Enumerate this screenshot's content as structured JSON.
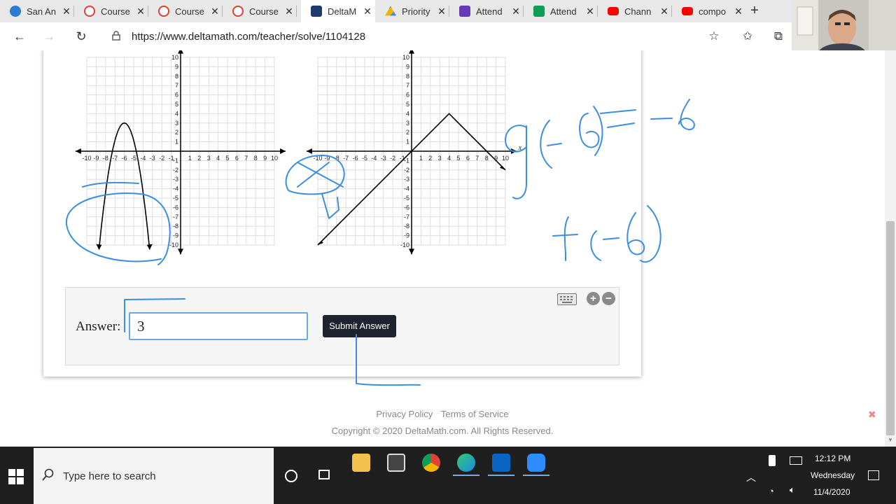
{
  "browser": {
    "tabs": [
      {
        "label": "San An",
        "icon": "onedrive-icon",
        "color": "#2b7cd3"
      },
      {
        "label": "Course",
        "icon": "canvas-icon",
        "color": "#d94136"
      },
      {
        "label": "Course",
        "icon": "canvas-icon",
        "color": "#d94136"
      },
      {
        "label": "Course",
        "icon": "canvas-icon",
        "color": "#d94136"
      },
      {
        "label": "DeltaM",
        "icon": "deltamath-icon",
        "color": "#1f3b6e"
      },
      {
        "label": "Priority",
        "icon": "google-drive-icon",
        "color": "#f4b400"
      },
      {
        "label": "Attend",
        "icon": "forms-icon",
        "color": "#673ab7"
      },
      {
        "label": "Attend",
        "icon": "sheets-icon",
        "color": "#0f9d58"
      },
      {
        "label": "Chann",
        "icon": "youtube-icon",
        "color": "#ff0000"
      },
      {
        "label": "compo",
        "icon": "youtube-icon",
        "color": "#ff0000"
      }
    ],
    "active_tab": 4,
    "url": "https://www.deltamath.com/teacher/solve/1104128"
  },
  "graphs": {
    "left": {
      "x_ticks": [
        "-10",
        "-9",
        "-8",
        "-7",
        "-6",
        "-5",
        "-4",
        "-3",
        "-2",
        "-1",
        "1",
        "2",
        "3",
        "4",
        "5",
        "6",
        "7",
        "8",
        "9",
        "10"
      ],
      "y_ticks": [
        "10",
        "9",
        "8",
        "7",
        "6",
        "5",
        "4",
        "3",
        "2",
        "1",
        "-1",
        "-2",
        "-3",
        "-4",
        "-5",
        "-6",
        "-7",
        "-8",
        "-9",
        "-10"
      ]
    },
    "right": {
      "x_ticks": [
        "-10",
        "-9",
        "-8",
        "-7",
        "-6",
        "-5",
        "-4",
        "-3",
        "-2",
        "-1",
        "1",
        "2",
        "3",
        "4",
        "5",
        "6",
        "7",
        "8",
        "9",
        "10"
      ],
      "y_ticks": [
        "10",
        "9",
        "8",
        "7",
        "6",
        "5",
        "4",
        "3",
        "2",
        "1",
        "-1",
        "-2",
        "-3",
        "-4",
        "-5",
        "-6",
        "-7",
        "-8",
        "-9",
        "-10"
      ],
      "axis_label": "x"
    }
  },
  "annotations": {
    "line1": "g(-6) = -6",
    "line2": "f(-6)"
  },
  "answer": {
    "label": "Answer:",
    "value": "3",
    "submit_label": "Submit Answer"
  },
  "footer": {
    "privacy": "Privacy Policy",
    "terms": "Terms of Service",
    "copyright": "Copyright © 2020 DeltaMath.com. All Rights Reserved."
  },
  "taskbar": {
    "search_placeholder": "Type here to search",
    "time": "12:12 PM",
    "day": "Wednesday",
    "date": "11/4/2020"
  },
  "colors": {
    "accent_blue": "#2f7fd8",
    "ink": "#3b8ee0",
    "submit_bg": "#1d2430"
  }
}
